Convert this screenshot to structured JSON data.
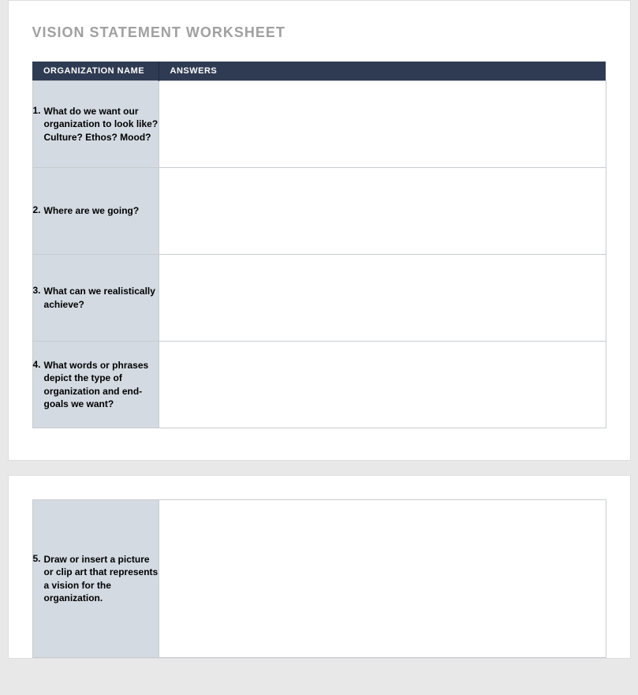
{
  "title": "VISION STATEMENT WORKSHEET",
  "header": {
    "col1": "ORGANIZATION NAME",
    "col2": "ANSWERS"
  },
  "questions": [
    {
      "num": "1.",
      "text": "What do we want our organization to look like? Culture? Ethos? Mood?",
      "answer": ""
    },
    {
      "num": "2.",
      "text": "Where are we going?",
      "answer": ""
    },
    {
      "num": "3.",
      "text": "What can we realistically achieve?",
      "answer": ""
    },
    {
      "num": "4.",
      "text": "What words or phrases depict the type of organization and end-goals we want?",
      "answer": ""
    },
    {
      "num": "5.",
      "text": "Draw or insert a picture or clip art that represents a vision for the organization.",
      "answer": ""
    }
  ]
}
